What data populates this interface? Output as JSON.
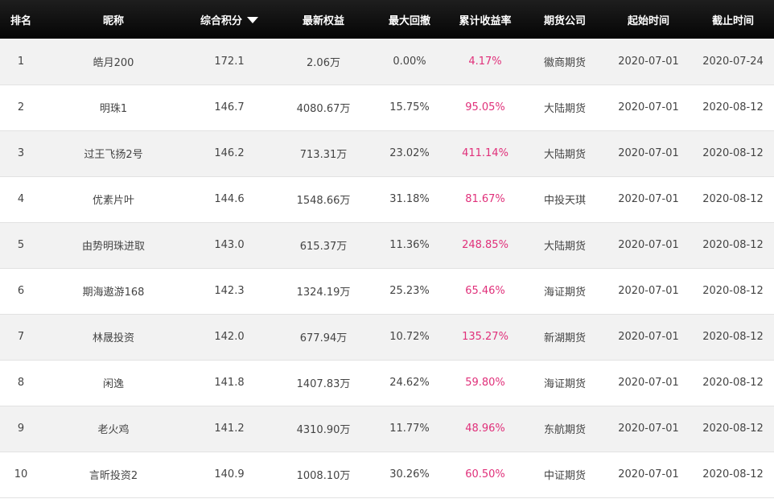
{
  "table": {
    "headers": {
      "rank": "排名",
      "nickname": "昵称",
      "score": "综合积分",
      "equity": "最新权益",
      "max_drawdown": "最大回撤",
      "cumulative_return": "累计收益率",
      "company": "期货公司",
      "start_date": "起始时间",
      "end_date": "截止时间"
    },
    "sort": {
      "column": "score",
      "direction": "desc",
      "icon": "triangle-down-icon"
    },
    "return_color": "#e0307a",
    "header_bg": "#0f0f0f",
    "rows": [
      {
        "rank": "1",
        "nickname": "皓月200",
        "score": "172.1",
        "equity": "2.06万",
        "max_drawdown": "0.00%",
        "cumulative_return": "4.17%",
        "company": "徽商期货",
        "start_date": "2020-07-01",
        "end_date": "2020-07-24"
      },
      {
        "rank": "2",
        "nickname": "明珠1",
        "score": "146.7",
        "equity": "4080.67万",
        "max_drawdown": "15.75%",
        "cumulative_return": "95.05%",
        "company": "大陆期货",
        "start_date": "2020-07-01",
        "end_date": "2020-08-12"
      },
      {
        "rank": "3",
        "nickname": "过王飞扬2号",
        "score": "146.2",
        "equity": "713.31万",
        "max_drawdown": "23.02%",
        "cumulative_return": "411.14%",
        "company": "大陆期货",
        "start_date": "2020-07-01",
        "end_date": "2020-08-12"
      },
      {
        "rank": "4",
        "nickname": "优素片叶",
        "score": "144.6",
        "equity": "1548.66万",
        "max_drawdown": "31.18%",
        "cumulative_return": "81.67%",
        "company": "中投天琪",
        "start_date": "2020-07-01",
        "end_date": "2020-08-12"
      },
      {
        "rank": "5",
        "nickname": "由势明珠进取",
        "score": "143.0",
        "equity": "615.37万",
        "max_drawdown": "11.36%",
        "cumulative_return": "248.85%",
        "company": "大陆期货",
        "start_date": "2020-07-01",
        "end_date": "2020-08-12"
      },
      {
        "rank": "6",
        "nickname": "期海遨游168",
        "score": "142.3",
        "equity": "1324.19万",
        "max_drawdown": "25.23%",
        "cumulative_return": "65.46%",
        "company": "海证期货",
        "start_date": "2020-07-01",
        "end_date": "2020-08-12"
      },
      {
        "rank": "7",
        "nickname": "林晟投资",
        "score": "142.0",
        "equity": "677.94万",
        "max_drawdown": "10.72%",
        "cumulative_return": "135.27%",
        "company": "新湖期货",
        "start_date": "2020-07-01",
        "end_date": "2020-08-12"
      },
      {
        "rank": "8",
        "nickname": "闲逸",
        "score": "141.8",
        "equity": "1407.83万",
        "max_drawdown": "24.62%",
        "cumulative_return": "59.80%",
        "company": "海证期货",
        "start_date": "2020-07-01",
        "end_date": "2020-08-12"
      },
      {
        "rank": "9",
        "nickname": "老火鸡",
        "score": "141.2",
        "equity": "4310.90万",
        "max_drawdown": "11.77%",
        "cumulative_return": "48.96%",
        "company": "东航期货",
        "start_date": "2020-07-01",
        "end_date": "2020-08-12"
      },
      {
        "rank": "10",
        "nickname": "言昕投资2",
        "score": "140.9",
        "equity": "1008.10万",
        "max_drawdown": "30.26%",
        "cumulative_return": "60.50%",
        "company": "中证期货",
        "start_date": "2020-07-01",
        "end_date": "2020-08-12"
      }
    ]
  }
}
